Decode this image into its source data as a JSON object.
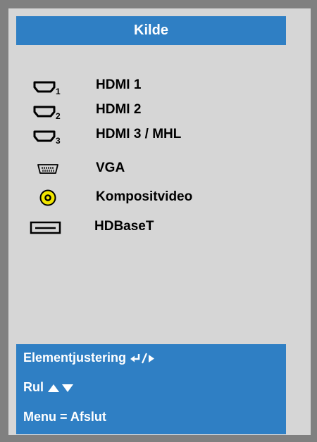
{
  "title": "Kilde",
  "sources": [
    {
      "label": "HDMI 1",
      "icon": "hdmi-port-1-icon",
      "subscript": "1"
    },
    {
      "label": "HDMI 2",
      "icon": "hdmi-port-2-icon",
      "subscript": "2"
    },
    {
      "label": "HDMI 3 / MHL",
      "icon": "hdmi-port-3-icon",
      "subscript": "3"
    },
    {
      "label": "VGA",
      "icon": "vga-port-icon"
    },
    {
      "label": "Kompositvideo",
      "icon": "composite-video-icon"
    },
    {
      "label": "HDBaseT",
      "icon": "hdbaset-port-icon"
    }
  ],
  "help": {
    "adjust": "Elementjustering",
    "scroll": "Rul",
    "exit": "Menu = Afslut"
  },
  "colors": {
    "frame": "#808080",
    "panel": "#d6d6d6",
    "accent": "#2f7fc4",
    "composite_yellow": "#f2e600"
  }
}
